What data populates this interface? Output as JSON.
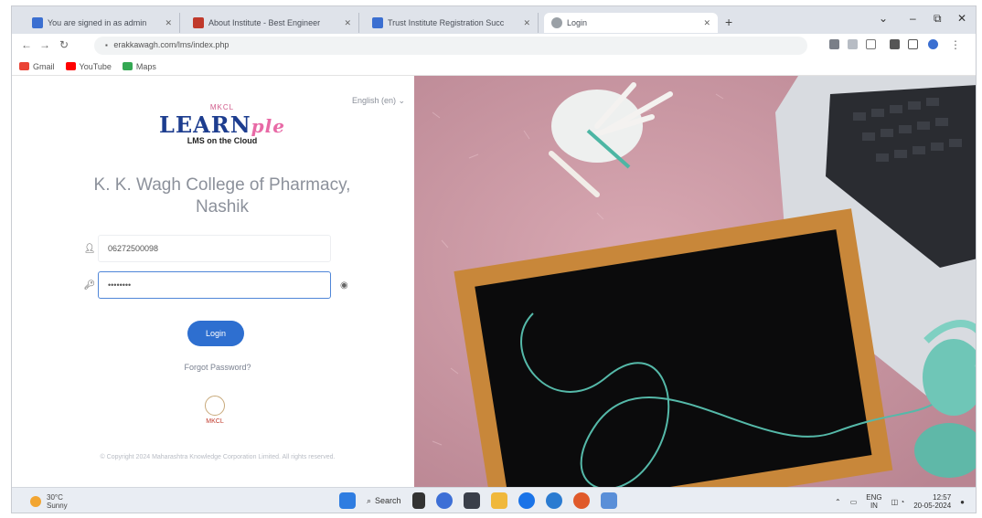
{
  "tabs": [
    {
      "label": "You are signed in as admin",
      "favicon_color": "#3b6fd1"
    },
    {
      "label": "About Institute - Best Engineer",
      "favicon_color": "#c0392b"
    },
    {
      "label": "Trust Institute Registration Succ",
      "favicon_color": "#3b6fd1"
    },
    {
      "label": "Login",
      "favicon_color": "#9aa0a6"
    }
  ],
  "window_controls": {
    "minimize": "–",
    "restore": "⧉",
    "close": "✕",
    "chevron": "⌄"
  },
  "address_bar": {
    "url": "erakkawagh.com/lms/index.php"
  },
  "bookmarks": [
    {
      "label": "Gmail",
      "color": "#ea4335"
    },
    {
      "label": "YouTube",
      "color": "#ff0000"
    },
    {
      "label": "Maps",
      "color": "#34a853"
    }
  ],
  "login": {
    "language": "English (en) ⌄",
    "logo_small": "MKCL",
    "logo_main": "LEARN",
    "logo_swash": "ple",
    "logo_tagline": "LMS on the Cloud",
    "institution": "K. K. Wagh College of Pharmacy, Nashik",
    "username_value": "06272500098",
    "password_value": "••••••••",
    "login_label": "Login",
    "forgot_label": "Forgot Password?",
    "footer_brand": "MKCL",
    "copyright": "© Copyright 2024 Maharashtra Knowledge Corporation Limited. All rights reserved."
  },
  "taskbar": {
    "weather_temp": "30°C",
    "weather_desc": "Sunny",
    "search_label": "Search",
    "tray_lang": "ENG",
    "tray_region": "IN",
    "time": "12:57",
    "date": "20-05-2024"
  },
  "colors": {
    "accent": "#2e6fd0",
    "logo_blue": "#1d3d8f",
    "logo_pink": "#e86aa6",
    "blanket": "#c99aa6",
    "board_frame": "#c8873a"
  }
}
